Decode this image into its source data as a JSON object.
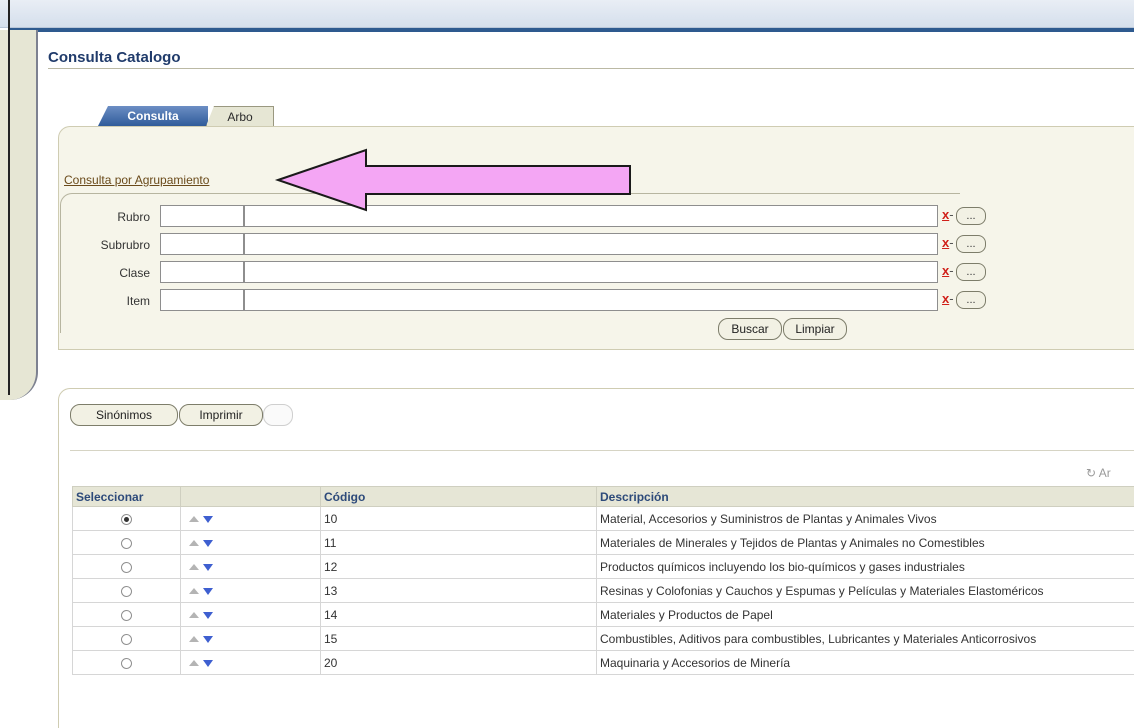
{
  "page": {
    "title": "Consulta Catalogo"
  },
  "tabs": [
    {
      "label": "Consulta",
      "active": true
    },
    {
      "label": "Arbo",
      "active": false
    }
  ],
  "search": {
    "group_link": "Consulta por Agrupamiento",
    "fields": [
      {
        "label": "Rubro",
        "code": "",
        "description": ""
      },
      {
        "label": "Subrubro",
        "code": "",
        "description": ""
      },
      {
        "label": "Clase",
        "code": "",
        "description": ""
      },
      {
        "label": "Item",
        "code": "",
        "description": ""
      }
    ],
    "clear_glyph": "x",
    "lov_label": "...",
    "buttons": {
      "search": "Buscar",
      "clear": "Limpiar"
    }
  },
  "results": {
    "buttons": {
      "synonyms": "Sinónimos",
      "print": "Imprimir"
    },
    "refresh_label": "Ar",
    "columns": [
      "Seleccionar",
      "",
      "Código",
      "Descripción"
    ],
    "rows": [
      {
        "selected": true,
        "code": "10",
        "description": "Material, Accesorios y Suministros de Plantas y Animales Vivos"
      },
      {
        "selected": false,
        "code": "11",
        "description": "Materiales de Minerales y Tejidos de Plantas y Animales no Comestibles"
      },
      {
        "selected": false,
        "code": "12",
        "description": "Productos químicos incluyendo los bio-químicos y gases industriales"
      },
      {
        "selected": false,
        "code": "13",
        "description": "Resinas y Colofonias y Cauchos y Espumas y Películas y Materiales Elastoméricos"
      },
      {
        "selected": false,
        "code": "14",
        "description": "Materiales y Productos de Papel"
      },
      {
        "selected": false,
        "code": "15",
        "description": "Combustibles, Aditivos para combustibles, Lubricantes y Materiales Anticorrosivos"
      },
      {
        "selected": false,
        "code": "20",
        "description": "Maquinaria y Accesorios de Minería"
      }
    ]
  },
  "colors": {
    "accent": "#2f5b9a",
    "arrow": "#f4a6f4",
    "header_text": "#2d4a7a"
  }
}
